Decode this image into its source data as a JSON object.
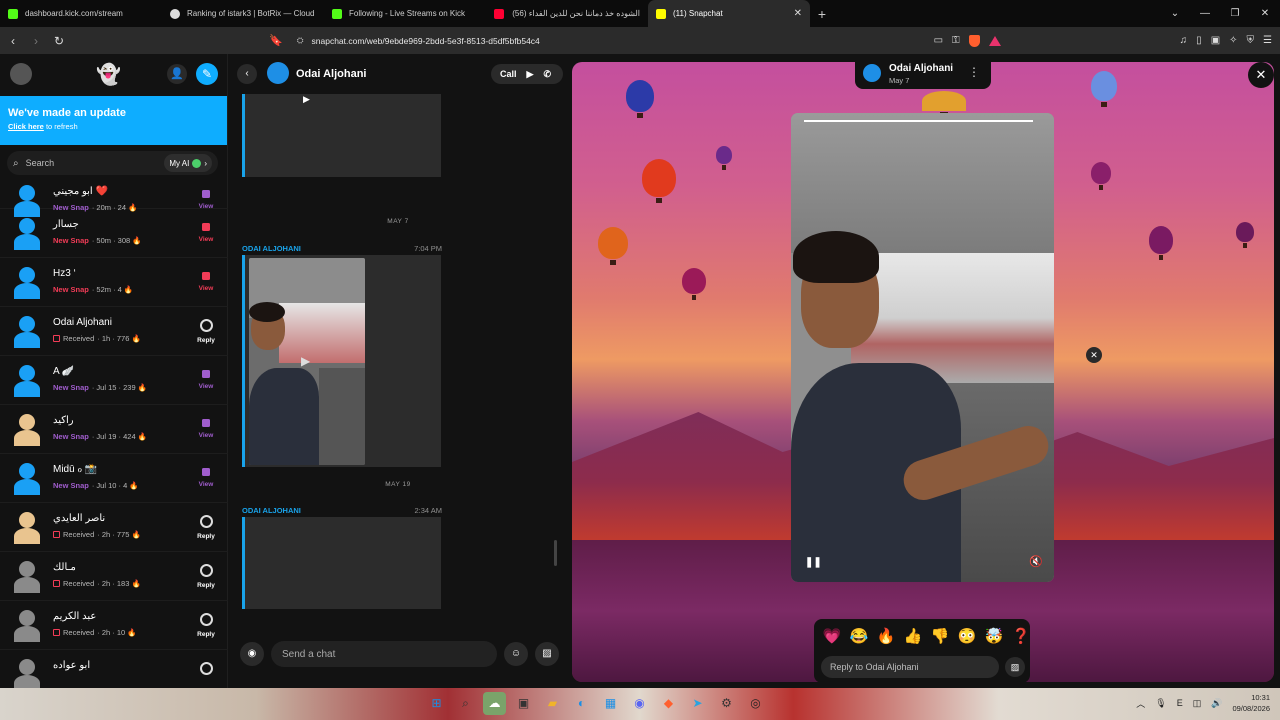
{
  "browser": {
    "tabs": [
      {
        "title": "dashboard.kick.com/stream",
        "color": "#53fc18"
      },
      {
        "title": "Ranking of istark3 | BotRix — Cloud",
        "color": "#dddddd"
      },
      {
        "title": "Following - Live Streams on Kick",
        "color": "#53fc18"
      },
      {
        "title": "الشوده خذ دماننا نحن للدين الفداء (56)",
        "color": "#ff0033"
      },
      {
        "title": "(11) Snapchat",
        "color": "#fffc00",
        "active": true
      }
    ],
    "url": "snapchat.com/web/9ebde969-2bdd-5e3f-8513-d5df5bfb54c4"
  },
  "sidebar": {
    "update_title": "We've made an update",
    "update_link": "Click here",
    "update_suffix": " to refresh",
    "search_placeholder": "Search",
    "myai_label": "My AI"
  },
  "chats": [
    {
      "name": "ابو مجيني ❤️",
      "status_type": "New Snap",
      "detail": "· 20m · 24 🔥",
      "indicator": "purple",
      "action": "View",
      "bitmoji": "#1aa0f5"
    },
    {
      "name": "جساار",
      "status_type": "New Snap",
      "detail": "· 50m · 308 🔥",
      "indicator": "red",
      "action": "View",
      "bitmoji": "#1aa0f5"
    },
    {
      "name": "Hz3 ‘",
      "status_type": "New Snap",
      "detail": "· 52m · 4 🔥",
      "indicator": "red",
      "action": "View",
      "bitmoji": "#1aa0f5"
    },
    {
      "name": "Odai Aljohani",
      "status_type": "Received",
      "detail": "· 1h · 776 🔥",
      "indicator": "camera",
      "action": "Reply",
      "bitmoji": "#1aa0f5"
    },
    {
      "name": "A 🪽",
      "status_type": "New Snap",
      "detail": "· Jul 15 · 239 🔥",
      "indicator": "purple",
      "action": "View",
      "bitmoji": "#1aa0f5"
    },
    {
      "name": "راكيد",
      "status_type": "New Snap",
      "detail": "· Jul 19 · 424 🔥",
      "indicator": "purple",
      "action": "View",
      "bitmoji": "#e9c48f"
    },
    {
      "name": "Midū ℴ 📸",
      "status_type": "New Snap",
      "detail": "· Jul 10 · 4 🔥",
      "indicator": "purple",
      "action": "View",
      "bitmoji": "#1aa0f5"
    },
    {
      "name": "ناصر العايدي",
      "status_type": "Received",
      "detail": "· 2h · 775 🔥",
      "indicator": "camera",
      "action": "Reply",
      "bitmoji": "#e9c48f"
    },
    {
      "name": "مـالك",
      "status_type": "Received",
      "detail": "· 2h · 183 🔥",
      "indicator": "camera",
      "action": "Reply",
      "bitmoji": "#8a8a8a"
    },
    {
      "name": "عبد الكريم",
      "status_type": "Received",
      "detail": "· 2h · 10 🔥",
      "indicator": "camera",
      "action": "Reply",
      "bitmoji": "#8a8a8a"
    },
    {
      "name": "ابو عواده",
      "status_type": "",
      "detail": "",
      "indicator": "camera",
      "action": "",
      "bitmoji": "#8a8a8a"
    }
  ],
  "conversation": {
    "contact_name": "Odai Aljohani",
    "call_label": "Call",
    "dates": [
      "MAY 7",
      "MAY 19"
    ],
    "sender_label": "ODAI ALJOHANI",
    "times": [
      "7:04 PM",
      "2:34 AM"
    ],
    "compose_placeholder": "Send a chat"
  },
  "story": {
    "name": "Odai Aljohani",
    "date": "May 7",
    "progress": 1.0,
    "reply_placeholder": "Reply to Odai Aljohani",
    "reactions": [
      "💗",
      "😂",
      "🔥",
      "👍",
      "👎",
      "😳",
      "🤯",
      "❓"
    ]
  },
  "taskbar": {
    "time": "10:31",
    "date": "09/08/2026"
  }
}
